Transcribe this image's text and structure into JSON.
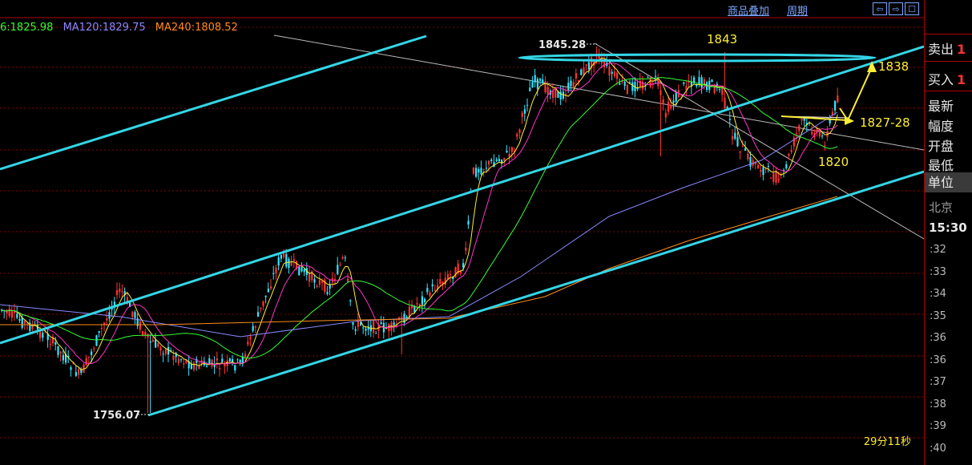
{
  "ma_legend": [
    {
      "text": "6:1825.98",
      "color": "#33ff33"
    },
    {
      "text": "MA120:1829.75",
      "color": "#8a8aff"
    },
    {
      "text": "MA240:1808.52",
      "color": "#ff8c1a"
    }
  ],
  "toolbar": {
    "overlay_label": "商品叠加",
    "period_label": "周期",
    "nav_buttons": [
      "⇦",
      "⇨",
      "☐"
    ]
  },
  "annotations": {
    "high_marker": "1845.28",
    "low_marker": "1756.07",
    "peak_level": "1843",
    "target_level": "1838",
    "resistance_level": "1827-28",
    "support_level": "1820"
  },
  "timer": "29分11秒",
  "side_panel": {
    "sell_label": "卖出",
    "sell_value": "1",
    "buy_label": "买入",
    "buy_value": "1",
    "latest_label": "最新",
    "range_label": "幅度",
    "open_label": "开盘",
    "low_label": "最低",
    "unit_label": "单位",
    "city": "北京",
    "time": "15:30",
    "ticks": [
      ":32",
      ":33",
      ":34",
      ":35",
      ":36",
      ":36",
      ":37",
      ":38",
      ":39",
      ":40"
    ]
  },
  "colors": {
    "up_candle": "#ff3333",
    "down_candle": "#33e6ff",
    "channel": "#33d6e6",
    "grid": "#8a0000",
    "annotation": "#ffee33"
  }
}
